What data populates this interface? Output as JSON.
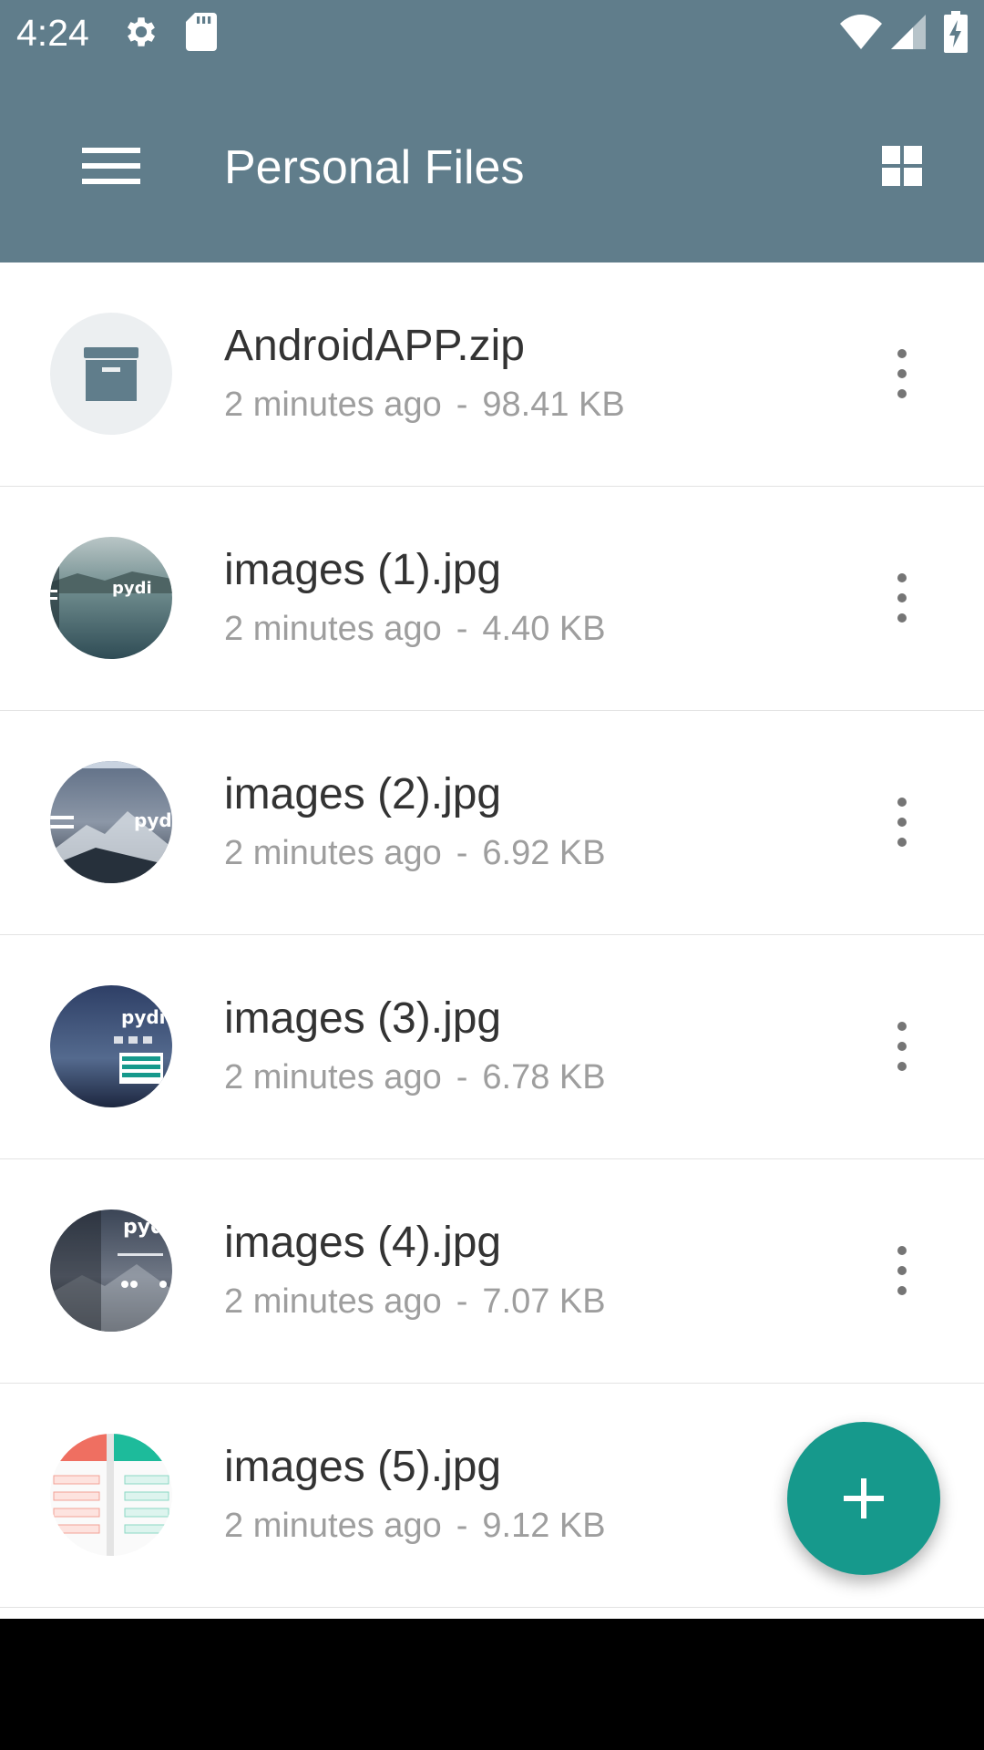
{
  "status_bar": {
    "time": "4:24",
    "icons": [
      "gear-icon",
      "sd-card-icon",
      "wifi-icon",
      "cell-signal-icon",
      "battery-charging-icon"
    ]
  },
  "app_bar": {
    "title": "Personal Files",
    "menu_icon": "hamburger-menu-icon",
    "view_toggle_icon": "grid-view-icon",
    "background_color": "#607d8b"
  },
  "files": [
    {
      "name": "AndroidAPP.zip",
      "modified": "2 minutes ago",
      "separator": "-",
      "size": "98.41 KB",
      "thumbnail": "archive-icon"
    },
    {
      "name": "images (1).jpg",
      "modified": "2 minutes ago",
      "separator": "-",
      "size": "4.40 KB",
      "thumbnail": "image-thumbnail"
    },
    {
      "name": "images (2).jpg",
      "modified": "2 minutes ago",
      "separator": "-",
      "size": "6.92 KB",
      "thumbnail": "image-thumbnail"
    },
    {
      "name": "images (3).jpg",
      "modified": "2 minutes ago",
      "separator": "-",
      "size": "6.78 KB",
      "thumbnail": "image-thumbnail"
    },
    {
      "name": "images (4).jpg",
      "modified": "2 minutes ago",
      "separator": "-",
      "size": "7.07 KB",
      "thumbnail": "image-thumbnail"
    },
    {
      "name": "images (5).jpg",
      "modified": "2 minutes ago",
      "separator": "-",
      "size": "9.12 KB",
      "thumbnail": "image-thumbnail"
    }
  ],
  "fab": {
    "icon": "plus-icon",
    "color": "#16998c"
  }
}
